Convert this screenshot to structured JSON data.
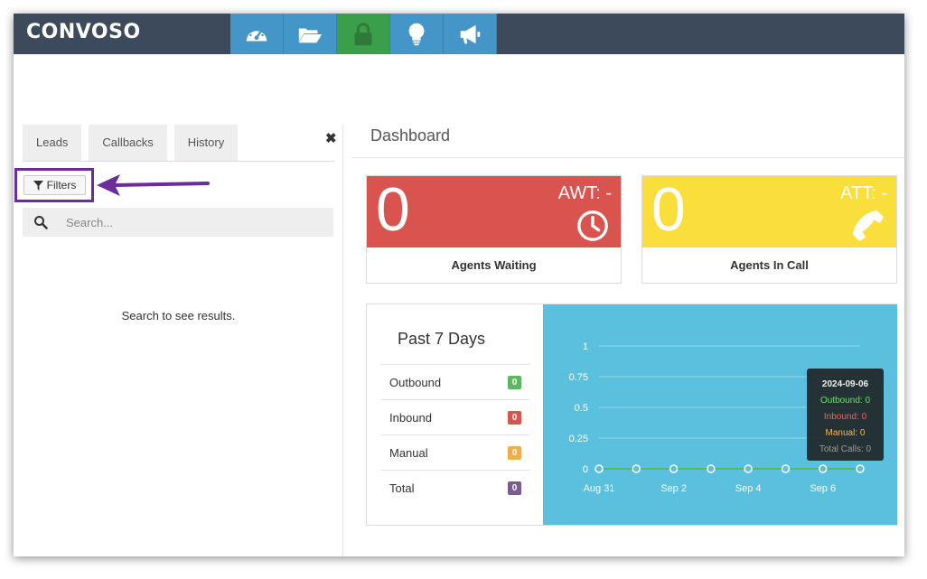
{
  "app": {
    "logo": "CONVOSO"
  },
  "nav": {
    "items": [
      {
        "icon": "dashboard-gauge-icon"
      },
      {
        "icon": "folder-open-icon"
      },
      {
        "icon": "lock-icon",
        "active": true
      },
      {
        "icon": "lightbulb-icon"
      },
      {
        "icon": "megaphone-icon"
      }
    ]
  },
  "left_panel": {
    "tabs": [
      "Leads",
      "Callbacks",
      "History"
    ],
    "close_icon": "close-icon",
    "filters_label": "Filters",
    "search_placeholder": "Search...",
    "empty_text": "Search to see results."
  },
  "dashboard": {
    "title": "Dashboard",
    "cards": [
      {
        "value": "0",
        "metric": "AWT: -",
        "label": "Agents Waiting",
        "color": "#d9534f",
        "icon": "clock-icon"
      },
      {
        "value": "0",
        "metric": "ATT: -",
        "label": "Agents In Call",
        "color": "#f9de3c",
        "icon": "phone-icon"
      }
    ],
    "stats": {
      "title": "Past 7 Days",
      "rows": [
        {
          "name": "Outbound",
          "count": "0",
          "color": "#5cb85c"
        },
        {
          "name": "Inbound",
          "count": "0",
          "color": "#d9534f"
        },
        {
          "name": "Manual",
          "count": "0",
          "color": "#f0ad4e"
        },
        {
          "name": "Total",
          "count": "0",
          "color": "#7b5c8f"
        }
      ]
    },
    "tooltip": {
      "date": "2024-09-06",
      "outbound": "Outbound: 0",
      "inbound": "Inbound: 0",
      "manual": "Manual: 0",
      "total": "Total Calls: 0"
    }
  },
  "chart_data": {
    "type": "line",
    "x": [
      "Aug 31",
      "Sep 1",
      "Sep 2",
      "Sep 3",
      "Sep 4",
      "Sep 5",
      "Sep 6",
      "Sep 7"
    ],
    "x_tick_labels": [
      "Aug 31",
      "Sep 2",
      "Sep 4",
      "Sep 6"
    ],
    "y_ticks": [
      "0",
      "0.25",
      "0.5",
      "0.75",
      "1"
    ],
    "ylim": [
      0,
      1
    ],
    "grid": true,
    "series": [
      {
        "values": [
          0,
          0,
          0,
          0,
          0,
          0,
          0,
          0
        ],
        "color": "#5cb85c"
      }
    ]
  }
}
